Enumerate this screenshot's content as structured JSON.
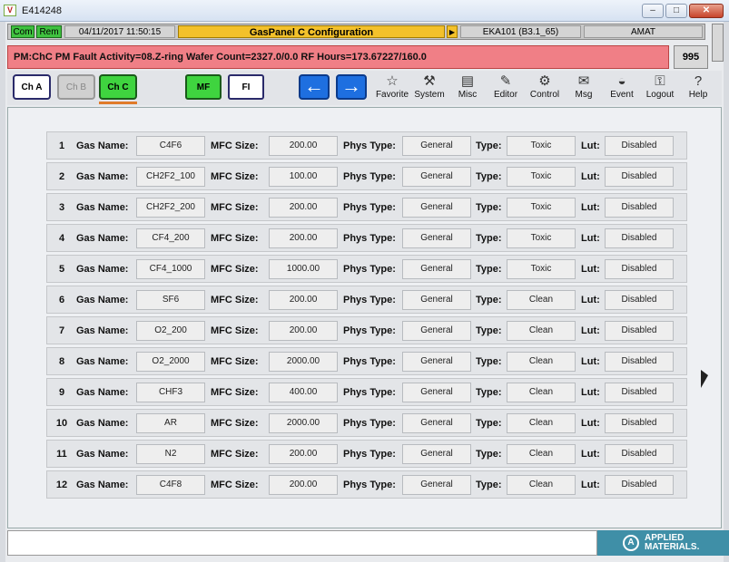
{
  "window": {
    "title": "E414248",
    "minimize": "–",
    "maximize": "□",
    "close": "✕"
  },
  "status": {
    "com": "Com",
    "rem": "Rem",
    "datetime": "04/11/2017 11:50:15",
    "title": "GasPanel C  Configuration",
    "arrow": "▶",
    "tool": "EKA101 (B3.1_65)",
    "user": "AMAT"
  },
  "alarm": {
    "text": "PM:ChC PM Fault Activity=08.Z-ring Wafer Count=2327.0/0.0 RF Hours=173.67227/160.0",
    "count": "995",
    "color": "#f07f86"
  },
  "toolbar": {
    "chA": "Ch A",
    "chB": "Ch B",
    "chC": "Ch C",
    "mf": "MF",
    "fi": "FI",
    "back_icon": "←",
    "forward_icon": "→",
    "tools": [
      {
        "label": "Favorite",
        "icon": "☆"
      },
      {
        "label": "System",
        "icon": "⚒"
      },
      {
        "label": "Misc",
        "icon": "▤"
      },
      {
        "label": "Editor",
        "icon": "✎"
      },
      {
        "label": "Control",
        "icon": "⚙"
      },
      {
        "label": "Msg",
        "icon": "✉"
      },
      {
        "label": "Event",
        "icon": "◒"
      },
      {
        "label": "Logout",
        "icon": "⚿"
      },
      {
        "label": "Help",
        "icon": "?"
      }
    ]
  },
  "labels": {
    "gas_name": "Gas Name:",
    "mfc_size": "MFC Size:",
    "phys_type": "Phys Type:",
    "type": "Type:",
    "lut": "Lut:"
  },
  "gases": [
    {
      "num": "1",
      "name": "C4F6",
      "mfc": "200.00",
      "phys": "General",
      "type": "Toxic",
      "lut": "Disabled"
    },
    {
      "num": "2",
      "name": "CH2F2_100",
      "mfc": "100.00",
      "phys": "General",
      "type": "Toxic",
      "lut": "Disabled"
    },
    {
      "num": "3",
      "name": "CH2F2_200",
      "mfc": "200.00",
      "phys": "General",
      "type": "Toxic",
      "lut": "Disabled"
    },
    {
      "num": "4",
      "name": "CF4_200",
      "mfc": "200.00",
      "phys": "General",
      "type": "Toxic",
      "lut": "Disabled"
    },
    {
      "num": "5",
      "name": "CF4_1000",
      "mfc": "1000.00",
      "phys": "General",
      "type": "Toxic",
      "lut": "Disabled"
    },
    {
      "num": "6",
      "name": "SF6",
      "mfc": "200.00",
      "phys": "General",
      "type": "Clean",
      "lut": "Disabled"
    },
    {
      "num": "7",
      "name": "O2_200",
      "mfc": "200.00",
      "phys": "General",
      "type": "Clean",
      "lut": "Disabled"
    },
    {
      "num": "8",
      "name": "O2_2000",
      "mfc": "2000.00",
      "phys": "General",
      "type": "Clean",
      "lut": "Disabled"
    },
    {
      "num": "9",
      "name": "CHF3",
      "mfc": "400.00",
      "phys": "General",
      "type": "Clean",
      "lut": "Disabled"
    },
    {
      "num": "10",
      "name": "AR",
      "mfc": "2000.00",
      "phys": "General",
      "type": "Clean",
      "lut": "Disabled"
    },
    {
      "num": "11",
      "name": "N2",
      "mfc": "200.00",
      "phys": "General",
      "type": "Clean",
      "lut": "Disabled"
    },
    {
      "num": "12",
      "name": "C4F8",
      "mfc": "200.00",
      "phys": "General",
      "type": "Clean",
      "lut": "Disabled"
    }
  ],
  "footer": {
    "logo_line1": "APPLIED",
    "logo_line2": "MATERIALS."
  }
}
